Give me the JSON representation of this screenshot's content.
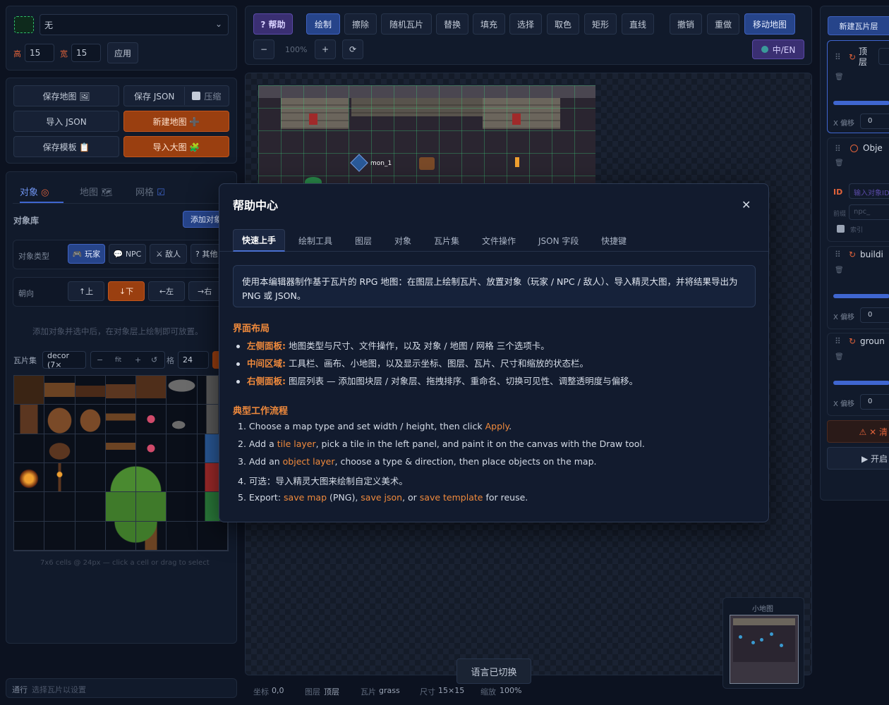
{
  "left": {
    "map_type_value": "无",
    "height_label": "高",
    "height_value": "15",
    "width_label": "宽",
    "width_value": "15",
    "apply_label": "应用",
    "save_map_label": "保存地图 🖼",
    "save_json_label": "保存 JSON",
    "compress_label": "压缩",
    "import_json_label": "导入 JSON",
    "new_map_label": "新建地图 ➕",
    "save_template_label": "保存模板 📋",
    "import_sheet_label": "导入大图 🧩",
    "tabs": [
      {
        "label": "对象"
      },
      {
        "label": "地图"
      },
      {
        "label": "网格"
      }
    ],
    "object_lib_label": "对象库",
    "add_object_label": "添加对象",
    "object_type_label": "对象类型",
    "object_types": [
      "🎮 玩家",
      "💬 NPC",
      "⚔ 敌人",
      "? 其他"
    ],
    "direction_label": "朝向",
    "directions": [
      "↑上",
      "↓下",
      "←左",
      "→右"
    ],
    "hint": "添加对象并选中后，在对象层上绘制即可放置。",
    "tileset_label": "瓦片集",
    "tileset_value": "decor (7×",
    "zoom_minus": "−",
    "zoom_fit": "fit",
    "zoom_plus": "+",
    "zoom_reset": "↺",
    "cell_label": "格",
    "cell_value": "24",
    "tileset_caption": "7x6 cells @ 24px — click a cell or drag to select",
    "passable_label": "通行",
    "passable_value": "选择瓦片以设置"
  },
  "toolbar": {
    "help": "? 帮助",
    "tools": [
      "绘制",
      "擦除",
      "随机瓦片",
      "替换",
      "填充",
      "选择",
      "取色",
      "矩形",
      "直线"
    ],
    "undo": "撤销",
    "redo": "重做",
    "pan": "移动地图",
    "zoom_out": "−",
    "zoom_value": "100%",
    "zoom_in": "+",
    "reset": "⟳",
    "lang": "中/EN"
  },
  "canvas": {
    "object_label": "mon_1",
    "minimap_label": "小地图",
    "toast": "语言已切换"
  },
  "statusbar": {
    "coord_label": "坐标",
    "coord_value": "0,0",
    "layer_label": "图层",
    "layer_value": "顶层",
    "tile_label": "瓦片",
    "tile_value": "grass",
    "size_label": "尺寸",
    "size_value": "15×15",
    "zoom_label": "缩放",
    "zoom_value": "100%"
  },
  "right": {
    "new_tile_layer": "新建瓦片层",
    "layers": [
      {
        "name": "顶层",
        "offset_label": "X 偏移",
        "offset_value": "0"
      },
      {
        "name": "Obje",
        "id_label": "ID",
        "id_placeholder": "输入对象ID",
        "prefix_label": "前缀",
        "prefix_value": "npc_",
        "index_label": "索引"
      },
      {
        "name": "buildi",
        "offset_label": "X 偏移",
        "offset_value": "0"
      },
      {
        "name": "groun",
        "offset_label": "X 偏移",
        "offset_value": "0"
      }
    ],
    "clear_label": "⚠ ✕ 清",
    "start_label": "▶ 开启"
  },
  "modal": {
    "title": "帮助中心",
    "close": "✕",
    "tabs": [
      "快速上手",
      "绘制工具",
      "图层",
      "对象",
      "瓦片集",
      "文件操作",
      "JSON 字段",
      "快捷键"
    ],
    "intro": "使用本编辑器制作基于瓦片的 RPG 地图：在图层上绘制瓦片、放置对象（玩家 / NPC / 敌人）、导入精灵大图，并将结果导出为",
    "intro2": "PNG 或 JSON。",
    "layout_title": "界面布局",
    "layout_items": [
      {
        "key": "左侧面板:",
        "text": "地图类型与尺寸、文件操作，以及 对象 / 地图 / 网格 三个选项卡。"
      },
      {
        "key": "中间区域:",
        "text": "工具栏、画布、小地图，以及显示坐标、图层、瓦片、尺寸和缩放的状态栏。"
      },
      {
        "key": "右侧面板:",
        "text": "图层列表 — 添加图块层 / 对象层、拖拽排序、重命名、切换可见性、调整透明度与偏移。"
      }
    ],
    "workflow_title": "典型工作流程",
    "steps": [
      {
        "a": "1. Choose a map type and set width / height, then click ",
        "h1": "Apply",
        "b": ".",
        "h2": "",
        "c": "",
        "h3": "",
        "d": ""
      },
      {
        "a": "2. Add a ",
        "h1": "tile layer",
        "b": ", pick a tile in the left panel, and paint it on the canvas with the Draw tool.",
        "h2": "",
        "c": "",
        "h3": "",
        "d": ""
      },
      {
        "a": "3. Add an ",
        "h1": "object layer",
        "b": ", choose a type & direction, then place objects on the map.",
        "h2": "",
        "c": "",
        "h3": "",
        "d": ""
      },
      {
        "a": "4. 可选：导入精灵大图来绘制自定义美术。",
        "h1": "",
        "b": "",
        "h2": "",
        "c": "",
        "h3": "",
        "d": ""
      },
      {
        "a": "5. Export: ",
        "h1": "save map",
        "b": " (PNG), ",
        "h2": "save json",
        "c": ", or ",
        "h3": "save template",
        "d": " for reuse."
      }
    ]
  }
}
